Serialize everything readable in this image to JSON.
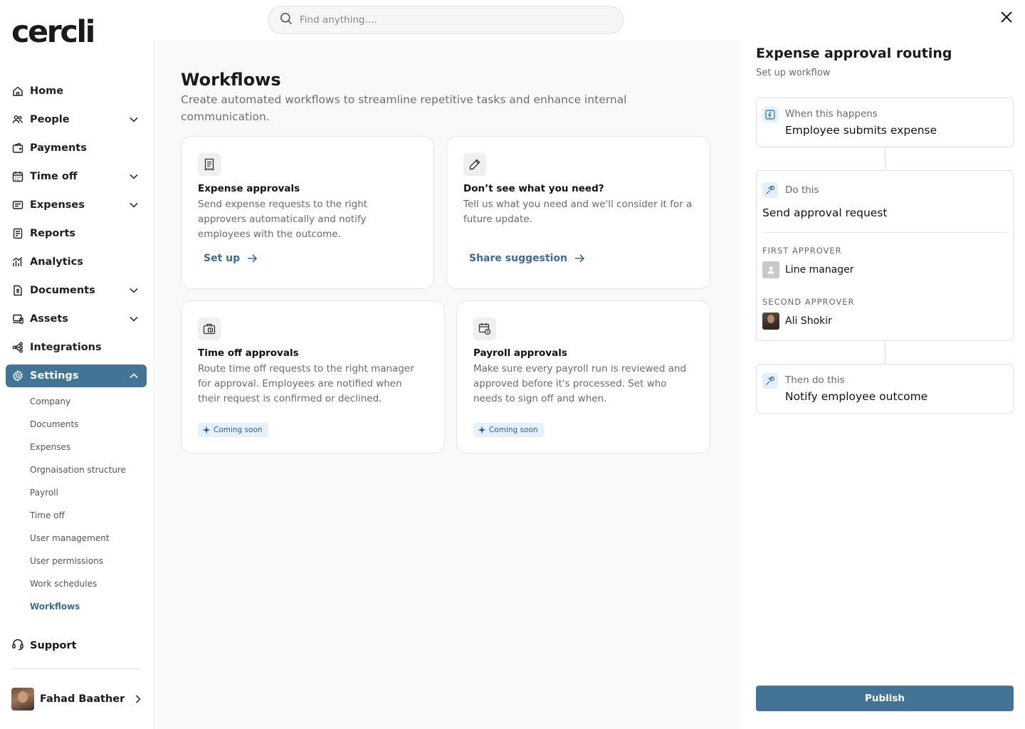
{
  "app": {
    "logo": "cercli"
  },
  "search": {
    "placeholder": "Find anything...."
  },
  "sidebar": {
    "items": [
      {
        "label": "Home",
        "icon": "home-icon"
      },
      {
        "label": "People",
        "icon": "people-icon",
        "expandable": true
      },
      {
        "label": "Payments",
        "icon": "wallet-icon"
      },
      {
        "label": "Time off",
        "icon": "calendar-icon",
        "expandable": true
      },
      {
        "label": "Expenses",
        "icon": "receipt-icon",
        "expandable": true
      },
      {
        "label": "Reports",
        "icon": "report-icon"
      },
      {
        "label": "Analytics",
        "icon": "analytics-icon"
      },
      {
        "label": "Documents",
        "icon": "documents-icon",
        "expandable": true
      },
      {
        "label": "Assets",
        "icon": "assets-icon",
        "expandable": true
      },
      {
        "label": "Integrations",
        "icon": "integrations-icon"
      },
      {
        "label": "Settings",
        "icon": "gear-icon",
        "expanded": true,
        "active": true
      }
    ],
    "settings_sub": [
      "Company",
      "Documents",
      "Expenses",
      "Orgnaisation structure",
      "Payroll",
      "Time off",
      "User management",
      "User permissions",
      "Work schedules",
      "Workflows"
    ],
    "active_sub": "Workflows",
    "support": "Support",
    "user": {
      "name": "Fahad Baather"
    }
  },
  "main": {
    "title": "Workflows",
    "description": "Create automated workflows to streamline repetitive tasks and enhance internal communication.",
    "cards": [
      {
        "title": "Expense approvals",
        "description": "Send expense requests to the right approvers automatically and notify employees with the outcome.",
        "action": "Set up",
        "icon": "receipt-icon"
      },
      {
        "title": "Don’t see what you need?",
        "description": "Tell us what you need and we'll consider it for a future update.",
        "action": "Share suggestion",
        "icon": "pencil-icon"
      },
      {
        "title": "Time off approvals",
        "description": "Route time off requests to the right manager for approval. Employees are notified when their request is confirmed or declined.",
        "badge": "Coming soon",
        "icon": "briefcase-icon"
      },
      {
        "title": "Payroll approvals",
        "description": "Make sure every payroll run is reviewed and approved before it's processed. Set who needs to sign off and when.",
        "badge": "Coming soon",
        "icon": "calendar-clock-icon"
      }
    ]
  },
  "panel": {
    "title": "Expense approval routing",
    "subtitle": "Set up workflow",
    "trigger": {
      "label": "When this happens",
      "value": "Employee submits expense"
    },
    "action": {
      "label": "Do this",
      "value": "Send approval request",
      "first_approver_label": "FIRST APPROVER",
      "first_approver": "Line manager",
      "second_approver_label": "SECOND APPROVER",
      "second_approver": "Ali Shokir"
    },
    "then": {
      "label": "Then do this",
      "value": "Notify employee outcome"
    },
    "publish_label": "Publish"
  },
  "colors": {
    "accent": "#427495",
    "link": "#3a6d8f",
    "badge_bg": "#e6f0fb"
  }
}
